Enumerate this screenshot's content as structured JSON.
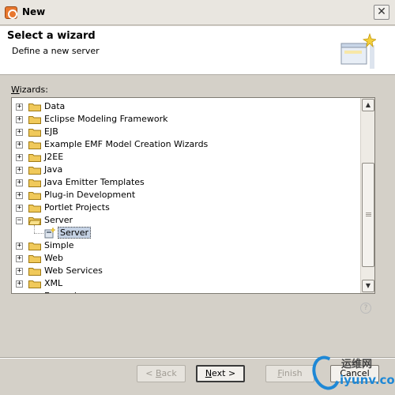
{
  "window": {
    "title": "New"
  },
  "header": {
    "title": "Select a wizard",
    "description": "Define a new server"
  },
  "wizards": {
    "label_prefix": "W",
    "label_rest": "izards:",
    "items": [
      {
        "label": "Data",
        "expanded": false
      },
      {
        "label": "Eclipse Modeling Framework",
        "expanded": false
      },
      {
        "label": "EJB",
        "expanded": false
      },
      {
        "label": "Example EMF Model Creation Wizards",
        "expanded": false
      },
      {
        "label": "J2EE",
        "expanded": false
      },
      {
        "label": "Java",
        "expanded": false
      },
      {
        "label": "Java Emitter Templates",
        "expanded": false
      },
      {
        "label": "Plug-in Development",
        "expanded": false
      },
      {
        "label": "Portlet Projects",
        "expanded": false
      },
      {
        "label": "Server",
        "expanded": true,
        "children": [
          {
            "label": "Server",
            "selected": true
          }
        ]
      },
      {
        "label": "Simple",
        "expanded": false
      },
      {
        "label": "Web",
        "expanded": false
      },
      {
        "label": "Web Services",
        "expanded": false
      },
      {
        "label": "XML",
        "expanded": false
      },
      {
        "label": "Examples",
        "expanded": false
      }
    ]
  },
  "buttons": {
    "back": {
      "prefix": "< ",
      "mnemonic": "B",
      "rest": "ack",
      "enabled": false
    },
    "next": {
      "mnemonic": "N",
      "rest": "ext >",
      "enabled": true
    },
    "finish": {
      "mnemonic": "F",
      "rest": "inish",
      "enabled": false
    },
    "cancel": {
      "label": "Cancel",
      "enabled": true
    }
  },
  "help": {
    "icon": "help-icon"
  },
  "watermark": {
    "top": "运维网",
    "bottom": "iyunv.com"
  },
  "colors": {
    "selection": "#c5d2e4",
    "folder": "#f0c95a",
    "accent": "#1e88d6"
  }
}
